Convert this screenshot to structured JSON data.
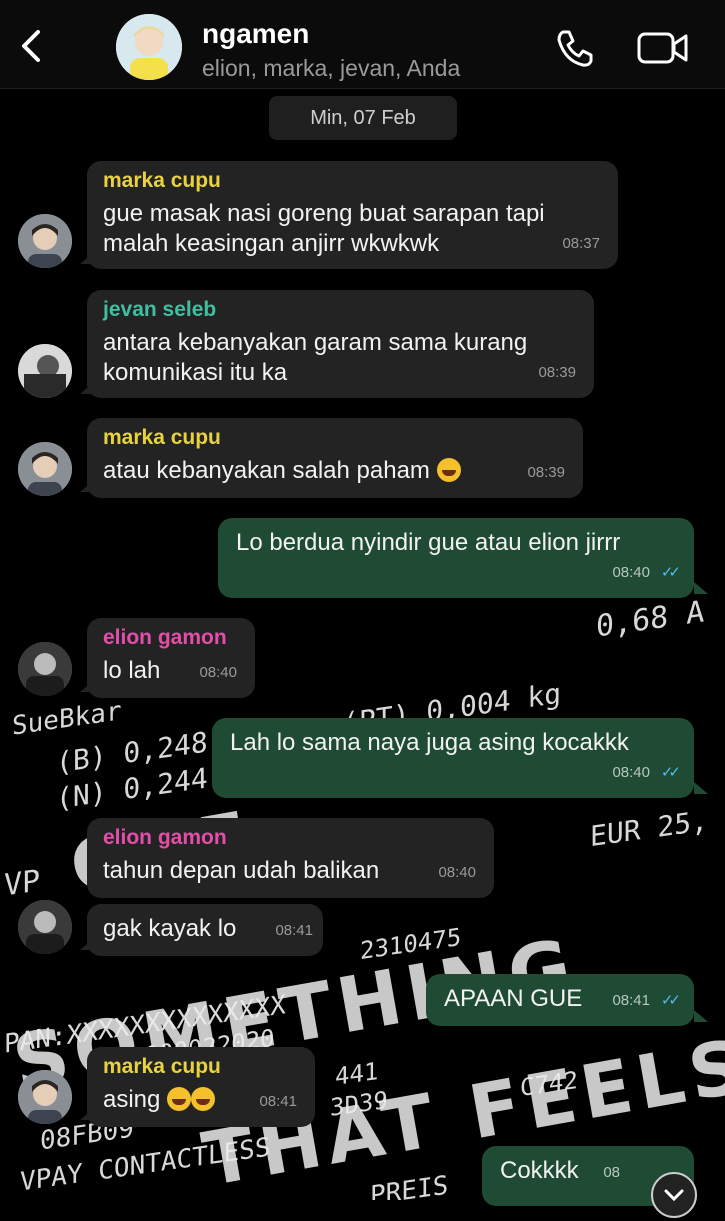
{
  "header": {
    "title": "ngamen",
    "subtitle": "elion, marka, jevan, Anda"
  },
  "date_chip": "Min, 07 Feb",
  "colors": {
    "outgoing": "#1f4a34",
    "incoming": "#232323",
    "marka": "#e8d33f",
    "jevan": "#3fbfa0",
    "elion": "#e34fa8",
    "read_tick": "#53bdeb"
  },
  "messages": [
    {
      "sender": "marka cupu",
      "lines": [
        "gue masak nasi goreng buat sarapan tapi",
        "malah keasingan anjirr wkwkwk"
      ],
      "time": "08:37"
    },
    {
      "sender": "jevan seleb",
      "lines": [
        "antara kebanyakan garam sama kurang",
        "komunikasi itu ka"
      ],
      "time": "08:39"
    },
    {
      "sender": "marka cupu",
      "text": "atau kebanyakan salah paham",
      "time": "08:39"
    },
    {
      "text": "Lo berdua nyindir gue atau elion jirrr",
      "time": "08:40"
    },
    {
      "sender": "elion gamon",
      "text": "lo lah",
      "time": "08:40"
    },
    {
      "text": "Lah lo sama naya juga asing kocakkk",
      "time": "08:40"
    },
    {
      "sender": "elion gamon",
      "text": "tahun depan udah balikan",
      "time": "08:40"
    },
    {
      "text": "gak kayak lo",
      "time": "08:41"
    },
    {
      "text": "APAAN GUE",
      "time": "08:41"
    },
    {
      "sender": "marka cupu",
      "text": "asing",
      "time": "08:41"
    },
    {
      "text": "Cokkkk",
      "time": "08"
    }
  ],
  "wallpaper": {
    "lines": [
      "0,68 A",
      "SueBkar",
      "(PT) 0,004 kg",
      "(B) 0,248",
      "(N) 0,244",
      "EUR 25,",
      "VP",
      "2310475",
      "PAN:XXXXXXXXXXXXXX",
      "0000022020",
      "08FB09",
      "VPAY CONTACTLESS",
      "441",
      "3D39",
      "C742",
      "PREIS"
    ],
    "big": [
      "GUE",
      "SOMETHING",
      "THAT FEELS"
    ]
  }
}
